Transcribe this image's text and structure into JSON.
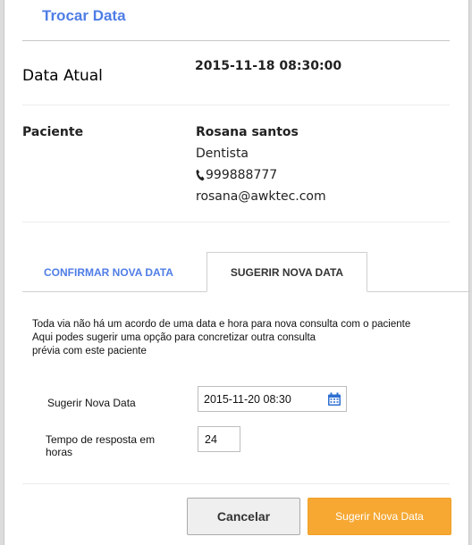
{
  "modal": {
    "title": "Trocar Data"
  },
  "current": {
    "label": "Data Atual",
    "value": "2015-11-18 08:30:00"
  },
  "patient": {
    "label": "Paciente",
    "name": "Rosana santos",
    "specialty": "Dentista",
    "phone": "999888777",
    "email": "rosana@awktec.com"
  },
  "tabs": [
    {
      "label": "CONFIRMAR NOVA DATA",
      "active": false
    },
    {
      "label": "SUGERIR NOVA DATA",
      "active": true
    }
  ],
  "suggest": {
    "description_lines": [
      "Toda via não há um acordo de uma data e hora para nova consulta com o paciente",
      "Aqui podes sugerir uma opção para concretizar outra consulta",
      "prévia com este paciente"
    ],
    "date_label": "Sugerir Nova Data",
    "date_value": "2015-11-20 08:30",
    "response_label_lines": [
      "Tempo de resposta em",
      "horas"
    ],
    "response_value": "24"
  },
  "buttons": {
    "cancel": "Cancelar",
    "submit": "Sugerir Nova Data"
  },
  "colors": {
    "accent": "#4f7de6",
    "submit": "#f6a833"
  },
  "icons": {
    "phone": "phone-icon",
    "calendar": "calendar-icon"
  }
}
